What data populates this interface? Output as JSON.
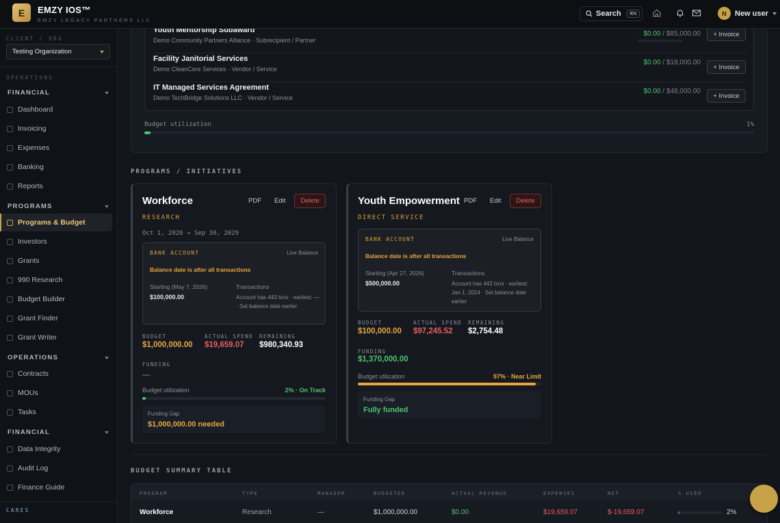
{
  "header": {
    "logo_letter": "E",
    "app_title": "EMZY IOS™",
    "app_subtitle": "EMZY LEGACY PARTNERS LLC",
    "search_label": "Search",
    "search_shortcut": "⌘K",
    "user_initial": "N",
    "user_name": "New user"
  },
  "sidebar": {
    "client_label": "CLIENT / ORG",
    "org_value": "Testing Organization",
    "operations_label": "OPERATIONS",
    "sections": [
      {
        "title": "FINANCIAL",
        "items": [
          "Dashboard",
          "Invoicing",
          "Expenses",
          "Banking",
          "Reports"
        ]
      },
      {
        "title": "PROGRAMS",
        "items": [
          "Programs & Budget",
          "Investors",
          "Grants",
          "990 Research",
          "Budget Builder",
          "Grant Finder",
          "Grant Writer"
        ]
      },
      {
        "title": "OPERATIONS",
        "items": [
          "Contracts",
          "MOUs",
          "Tasks"
        ]
      },
      {
        "title": "FINANCIAL",
        "items": [
          "Data Integrity",
          "Audit Log",
          "Finance Guide"
        ]
      }
    ],
    "active_item": "Programs & Budget",
    "footer_label": "CARES"
  },
  "contracts": [
    {
      "title": "Youth Mentorship Subaward",
      "subtitle": "Demo Community Partners Alliance · Subrecipient / Partner",
      "paid": "$0.00",
      "total": "/ $85,000.00",
      "action": "+ Invoice"
    },
    {
      "title": "Facility Janitorial Services",
      "subtitle": "Demo CleanCore Services · Vendor / Service",
      "paid": "$0.00",
      "total": "/ $18,000.00",
      "action": "+ Invoice"
    },
    {
      "title": "IT Managed Services Agreement",
      "subtitle": "Demo TechBridge Solutions LLC · Vendor / Service",
      "paid": "$0.00",
      "total": "/ $48,000.00",
      "action": "+ Invoice"
    }
  ],
  "budget_utilization": {
    "label": "Budget utilization",
    "percent_text": "1%",
    "fraction": 0.01
  },
  "programs_heading": "PROGRAMS / INITIATIVES",
  "programs": [
    {
      "name": "Workforce",
      "type": "RESEARCH",
      "dates": "Oct 1, 2026 → Sep 30, 2029",
      "pdf": "PDF",
      "edit": "Edit",
      "delete": "Delete",
      "bank_label": "BANK ACCOUNT",
      "bank_live": "Live Balance",
      "bank_warning": "Balance date is after all transactions",
      "starting_label": "Starting (May 7, 2026)",
      "starting_value": "$100,000.00",
      "tx_label": "Transactions",
      "tx_note": "Account has 443 txns · earliest: — · Set balance date earlier",
      "budget_label": "BUDGET",
      "budget": "$1,000,000.00",
      "spend_label": "ACTUAL SPEND",
      "spend": "$19,659.07",
      "remaining_label": "REMAINING",
      "remaining": "$980,340.93",
      "funding_label": "FUNDING",
      "funding": "—",
      "util_label": "Budget utilization",
      "util_status": "2% · On Track",
      "util_fraction": 0.02,
      "gap_label": "Funding Gap",
      "gap_value": "$1,000,000.00 needed"
    },
    {
      "name": "Youth Empowerment",
      "type": "DIRECT SERVICE",
      "pdf": "PDF",
      "edit": "Edit",
      "delete": "Delete",
      "bank_label": "BANK ACCOUNT",
      "bank_live": "Live Balance",
      "bank_warning": "Balance date is after all transactions",
      "starting_label": "Starting (Apr 27, 2026)",
      "starting_value": "$500,000.00",
      "tx_label": "Transactions",
      "tx_note": "Account has 443 txns · earliest: Jan 1, 2024 · Set balance date earlier",
      "budget_label": "BUDGET",
      "budget": "$100,000.00",
      "spend_label": "ACTUAL SPEND",
      "spend": "$97,245.52",
      "remaining_label": "REMAINING",
      "remaining": "$2,754.48",
      "funding_label": "FUNDING",
      "funding": "$1,370,000.00",
      "util_label": "Budget utilization",
      "util_status": "97% · Near Limit",
      "util_fraction": 0.97,
      "gap_label": "Funding Gap",
      "gap_value": "Fully funded"
    }
  ],
  "summary": {
    "heading": "BUDGET SUMMARY TABLE",
    "columns": [
      "PROGRAM",
      "TYPE",
      "MANAGER",
      "BUDGETED",
      "ACTUAL REVENUE",
      "EXPENSES",
      "NET",
      "% USED"
    ],
    "rows": [
      {
        "program": "Workforce",
        "type": "Research",
        "manager": "—",
        "budgeted": "$1,000,000.00",
        "revenue": "$0.00",
        "expenses": "$19,659.07",
        "net": "$-19,659.07",
        "used": "2%",
        "used_fraction": 0.02
      }
    ]
  },
  "colors": {
    "accent_gold": "#c8a248",
    "positive": "#4cc36b",
    "negative": "#e7605c",
    "warning": "#e4a83f"
  }
}
